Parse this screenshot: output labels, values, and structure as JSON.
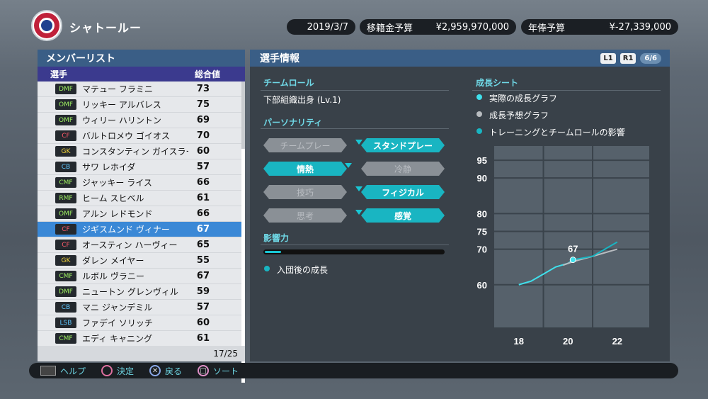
{
  "club": {
    "name": "シャトールー"
  },
  "header": {
    "date": "2019/3/7",
    "transfer_label": "移籍金予算",
    "transfer_value": "¥2,959,970,000",
    "salary_label": "年俸予算",
    "salary_value": "¥-27,339,000"
  },
  "member_list": {
    "title": "メンバーリスト",
    "col_player": "選手",
    "col_overall": "総合値",
    "count": "17/25",
    "players": [
      {
        "pos": "DMF",
        "name": "マテュー フラミニ",
        "ovr": "73",
        "cls": "mf"
      },
      {
        "pos": "OMF",
        "name": "リッキー アルバレス",
        "ovr": "75",
        "cls": "mf"
      },
      {
        "pos": "OMF",
        "name": "ウィリー ハリントン",
        "ovr": "69",
        "cls": "mf"
      },
      {
        "pos": "CF",
        "name": "バルトロメウ ゴイオス",
        "ovr": "70",
        "cls": "fw"
      },
      {
        "pos": "GK",
        "name": "コンスタンティン ガイスラー",
        "ovr": "60",
        "cls": "gk"
      },
      {
        "pos": "CB",
        "name": "サワ レホイダ",
        "ovr": "57",
        "cls": "df"
      },
      {
        "pos": "CMF",
        "name": "ジャッキー ライス",
        "ovr": "66",
        "cls": "mf"
      },
      {
        "pos": "RMF",
        "name": "ヒーム スヒベル",
        "ovr": "61",
        "cls": "mf"
      },
      {
        "pos": "OMF",
        "name": "アルン レドモンド",
        "ovr": "66",
        "cls": "mf"
      },
      {
        "pos": "CF",
        "name": "ジギスムンド ヴィナー",
        "ovr": "67",
        "cls": "fw"
      },
      {
        "pos": "CF",
        "name": "オースティン ハーヴィー",
        "ovr": "65",
        "cls": "fw"
      },
      {
        "pos": "GK",
        "name": "ダレン メイヤー",
        "ovr": "55",
        "cls": "gk"
      },
      {
        "pos": "CMF",
        "name": "ルボル ヴラニー",
        "ovr": "67",
        "cls": "mf"
      },
      {
        "pos": "DMF",
        "name": "ニュートン グレンヴィル",
        "ovr": "59",
        "cls": "mf"
      },
      {
        "pos": "CB",
        "name": "マニ ジャンデミル",
        "ovr": "57",
        "cls": "df"
      },
      {
        "pos": "LSB",
        "name": "ファデイ ソリッチ",
        "ovr": "60",
        "cls": "df"
      },
      {
        "pos": "CMF",
        "name": "エディ キャニング",
        "ovr": "61",
        "cls": "mf"
      }
    ],
    "selected_index": 9
  },
  "player_info": {
    "title": "選手情報",
    "tag_l1": "L1",
    "tag_r1": "R1",
    "page": "6/6",
    "team_role_heading": "チームロール",
    "team_role_value": "下部組織出身 (Lv.1)",
    "personality_heading": "パーソナリティ",
    "personality": [
      {
        "left": "チームプレー",
        "right": "スタンドプレー",
        "active": "right"
      },
      {
        "left": "情熱",
        "right": "冷静",
        "active": "left"
      },
      {
        "left": "技巧",
        "right": "フィジカル",
        "active": "right"
      },
      {
        "left": "思考",
        "right": "感覚",
        "active": "right"
      }
    ],
    "influence_heading": "影響力",
    "influence_level": 0.05,
    "influence_legend": "入団後の成長",
    "growth_heading": "成長シート",
    "legend": [
      "実際の成長グラフ",
      "成長予想グラフ",
      "トレーニングとチームロールの影響"
    ]
  },
  "chart_data": {
    "type": "line",
    "x_ticks": [
      18,
      20,
      22
    ],
    "y_ticks": [
      60,
      70,
      75,
      80,
      90,
      95
    ],
    "xlim": [
      17,
      23.3
    ],
    "ylim": [
      48,
      99
    ],
    "series": [
      {
        "name": "実際の成長グラフ",
        "color": "#3fe0ec",
        "x": [
          18,
          18.5,
          19,
          19.5,
          20,
          20.2
        ],
        "y": [
          60,
          61,
          63,
          65,
          66,
          67
        ]
      },
      {
        "name": "成長予想グラフ",
        "color": "#b8bcc0",
        "x": [
          19.8,
          20.2,
          21,
          22
        ],
        "y": [
          65.5,
          66.5,
          68,
          70
        ]
      },
      {
        "name": "トレーニングとチームロールの影響",
        "color": "#19b5c2",
        "x": [
          20.2,
          21,
          22
        ],
        "y": [
          67,
          68,
          72
        ]
      }
    ],
    "point_label": "67",
    "point": {
      "x": 20.2,
      "y": 67
    }
  },
  "bottom": {
    "help": "ヘルプ",
    "decide": "決定",
    "back": "戻る",
    "sort": "ソート"
  }
}
